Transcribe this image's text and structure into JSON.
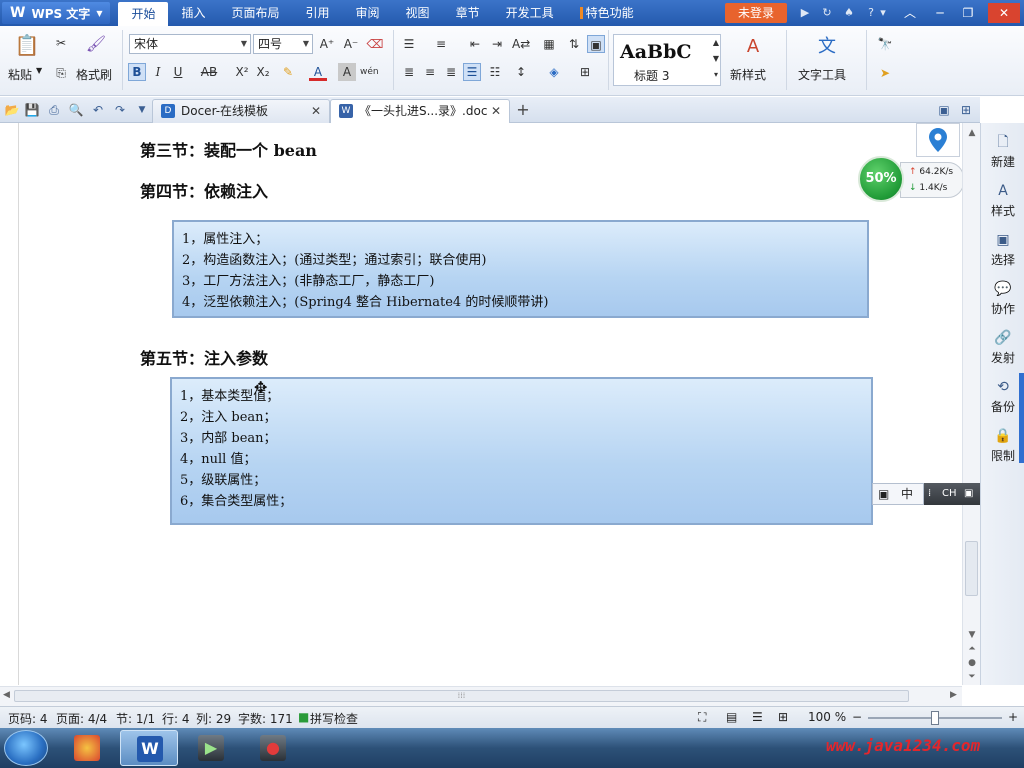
{
  "app": {
    "name": "WPS 文字",
    "login_label": "未登录"
  },
  "menu": {
    "items": [
      "开始",
      "插入",
      "页面布局",
      "引用",
      "审阅",
      "视图",
      "章节",
      "开发工具"
    ],
    "special_label": "特色功能"
  },
  "ribbon": {
    "paste_label": "粘贴",
    "format_painter_label": "格式刷",
    "font_name": "宋体",
    "font_size": "四号",
    "style_sample": "AaBbC",
    "style_name": "标题 3",
    "new_style_label": "新样式",
    "text_tools_label": "文字工具"
  },
  "tabs": [
    {
      "label": "Docer-在线模板",
      "active": false
    },
    {
      "label": "《一头扎进S...录》.doc",
      "active": true
    }
  ],
  "document": {
    "heading3": "第三节：装配一个 bean",
    "heading4": "第四节：依赖注入",
    "box1": [
      "1，属性注入；",
      "2，构造函数注入；(通过类型；通过索引；联合使用)",
      "3，工厂方法注入；(非静态工厂，静态工厂)",
      "4，泛型依赖注入；(Spring4 整合 Hibernate4 的时候顺带讲)"
    ],
    "heading5": "第五节：注入参数",
    "box2": [
      "1，基本类型值；",
      "2，注入 bean；",
      "3，内部 bean；",
      "4，null 值；",
      "5，级联属性；",
      "6，集合类型属性；"
    ]
  },
  "net_widget": {
    "percent": "50%",
    "upload": "64.2K/s",
    "download": "1.4K/s"
  },
  "ime": {
    "mode": "中",
    "lang": "CH"
  },
  "sidebar": {
    "items": [
      "新建",
      "样式",
      "选择",
      "协作",
      "发射",
      "备份",
      "限制"
    ]
  },
  "status": {
    "page_number": "页码: 4",
    "page_count": "页面: 4/4",
    "section": "节: 1/1",
    "row": "行: 4",
    "column": "列: 29",
    "word_count": "字数: 171",
    "spell_check": "拼写检查",
    "zoom": "100 %"
  },
  "zoom_level": 0.5,
  "taskbar": {
    "watermark": "www.java1234.com"
  }
}
